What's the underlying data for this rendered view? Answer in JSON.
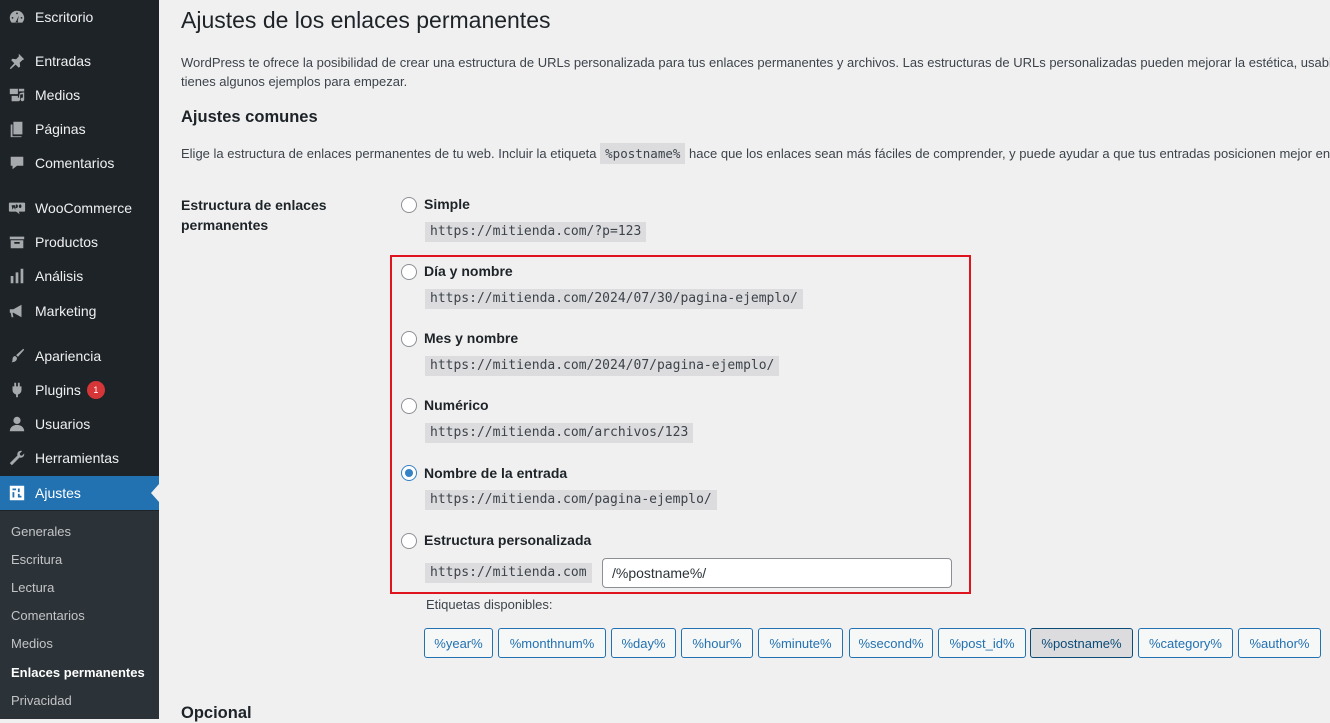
{
  "sidebar": {
    "items": [
      {
        "label": "Escritorio",
        "icon": "dashboard-icon"
      },
      {
        "label": "Entradas",
        "icon": "pin-icon"
      },
      {
        "label": "Medios",
        "icon": "media-icon"
      },
      {
        "label": "Páginas",
        "icon": "pages-icon"
      },
      {
        "label": "Comentarios",
        "icon": "comments-icon"
      },
      {
        "label": "WooCommerce",
        "icon": "woo-icon"
      },
      {
        "label": "Productos",
        "icon": "products-icon"
      },
      {
        "label": "Análisis",
        "icon": "chart-bar-icon"
      },
      {
        "label": "Marketing",
        "icon": "megaphone-icon"
      },
      {
        "label": "Apariencia",
        "icon": "brush-icon"
      },
      {
        "label": "Plugins",
        "icon": "plugin-icon",
        "badge": "1"
      },
      {
        "label": "Usuarios",
        "icon": "users-icon"
      },
      {
        "label": "Herramientas",
        "icon": "wrench-icon"
      },
      {
        "label": "Ajustes",
        "icon": "settings-icon",
        "active": true
      }
    ],
    "submenu": [
      {
        "label": "Generales"
      },
      {
        "label": "Escritura"
      },
      {
        "label": "Lectura"
      },
      {
        "label": "Comentarios"
      },
      {
        "label": "Medios"
      },
      {
        "label": "Enlaces permanentes",
        "current": true
      },
      {
        "label": "Privacidad"
      }
    ]
  },
  "page": {
    "title": "Ajustes de los enlaces permanentes",
    "intro_line1": "WordPress te ofrece la posibilidad de crear una estructura de URLs personalizada para tus enlaces permanentes y archivos. Las estructuras de URLs personalizadas pueden mejorar la estética, usabilid",
    "intro_line2": "tienes algunos ejemplos para empezar.",
    "section_title": "Ajustes comunes",
    "section_desc_before": "Elige la estructura de enlaces permanentes de tu web. Incluir la etiqueta",
    "section_desc_tag": "%postname%",
    "section_desc_after": "hace que los enlaces sean más fáciles de comprender, y puede ayudar a que tus entradas posicionen mejor en",
    "field_label": "Estructura de enlaces permanentes",
    "options": [
      {
        "label": "Simple",
        "url": "https://mitienda.com/?p=123",
        "checked": false
      },
      {
        "label": "Día y nombre",
        "url": "https://mitienda.com/2024/07/30/pagina-ejemplo/",
        "checked": false
      },
      {
        "label": "Mes y nombre",
        "url": "https://mitienda.com/2024/07/pagina-ejemplo/",
        "checked": false
      },
      {
        "label": "Numérico",
        "url": "https://mitienda.com/archivos/123",
        "checked": false
      },
      {
        "label": "Nombre de la entrada",
        "url": "https://mitienda.com/pagina-ejemplo/",
        "checked": true
      },
      {
        "label": "Estructura personalizada",
        "url": "https://mitienda.com",
        "checked": false
      }
    ],
    "custom_structure_value": "/%postname%/",
    "tags_label": "Etiquetas disponibles:",
    "tags": [
      "%year%",
      "%monthnum%",
      "%day%",
      "%hour%",
      "%minute%",
      "%second%",
      "%post_id%",
      "%postname%",
      "%category%",
      "%author%"
    ],
    "pressed_tag": "%postname%",
    "next_section_title": "Opcional"
  },
  "colors": {
    "accent": "#2271b1",
    "highlight_box": "#e0141e",
    "sidebar_bg": "#1d2327"
  }
}
